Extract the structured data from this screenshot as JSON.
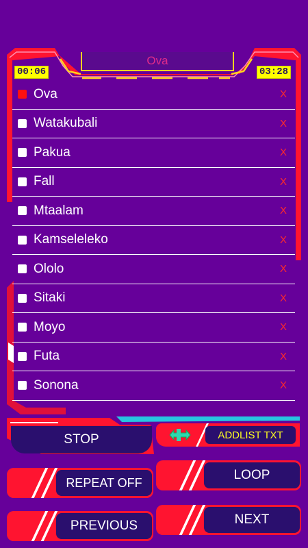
{
  "header": {
    "now_playing": "Ova",
    "elapsed": "00:06",
    "duration": "03:28"
  },
  "playlist": [
    {
      "title": "Ova",
      "active": true,
      "remove": "X"
    },
    {
      "title": "Watakubali",
      "active": false,
      "remove": "X"
    },
    {
      "title": "Pakua",
      "active": false,
      "remove": "X"
    },
    {
      "title": "Fall",
      "active": false,
      "remove": "X"
    },
    {
      "title": "Mtaalam",
      "active": false,
      "remove": "X"
    },
    {
      "title": "Kamseleleko",
      "active": false,
      "remove": "X"
    },
    {
      "title": "Ololo",
      "active": false,
      "remove": "X"
    },
    {
      "title": "Sitaki",
      "active": false,
      "remove": "X"
    },
    {
      "title": "Moyo",
      "active": false,
      "remove": "X"
    },
    {
      "title": "Futa",
      "active": false,
      "remove": "X"
    },
    {
      "title": "Sonona",
      "active": false,
      "remove": "X"
    }
  ],
  "controls": {
    "stop": "STOP",
    "addlist": "ADDLIST TXT",
    "repeat": "REPEAT OFF",
    "loop": "LOOP",
    "previous": "PREVIOUS",
    "next": "NEXT"
  },
  "colors": {
    "background": "#66009a",
    "accent_red": "#ff1e3c",
    "button_fill": "#2a0f6e",
    "timer_bg": "#ffff00",
    "title_text": "#e02b8a"
  }
}
